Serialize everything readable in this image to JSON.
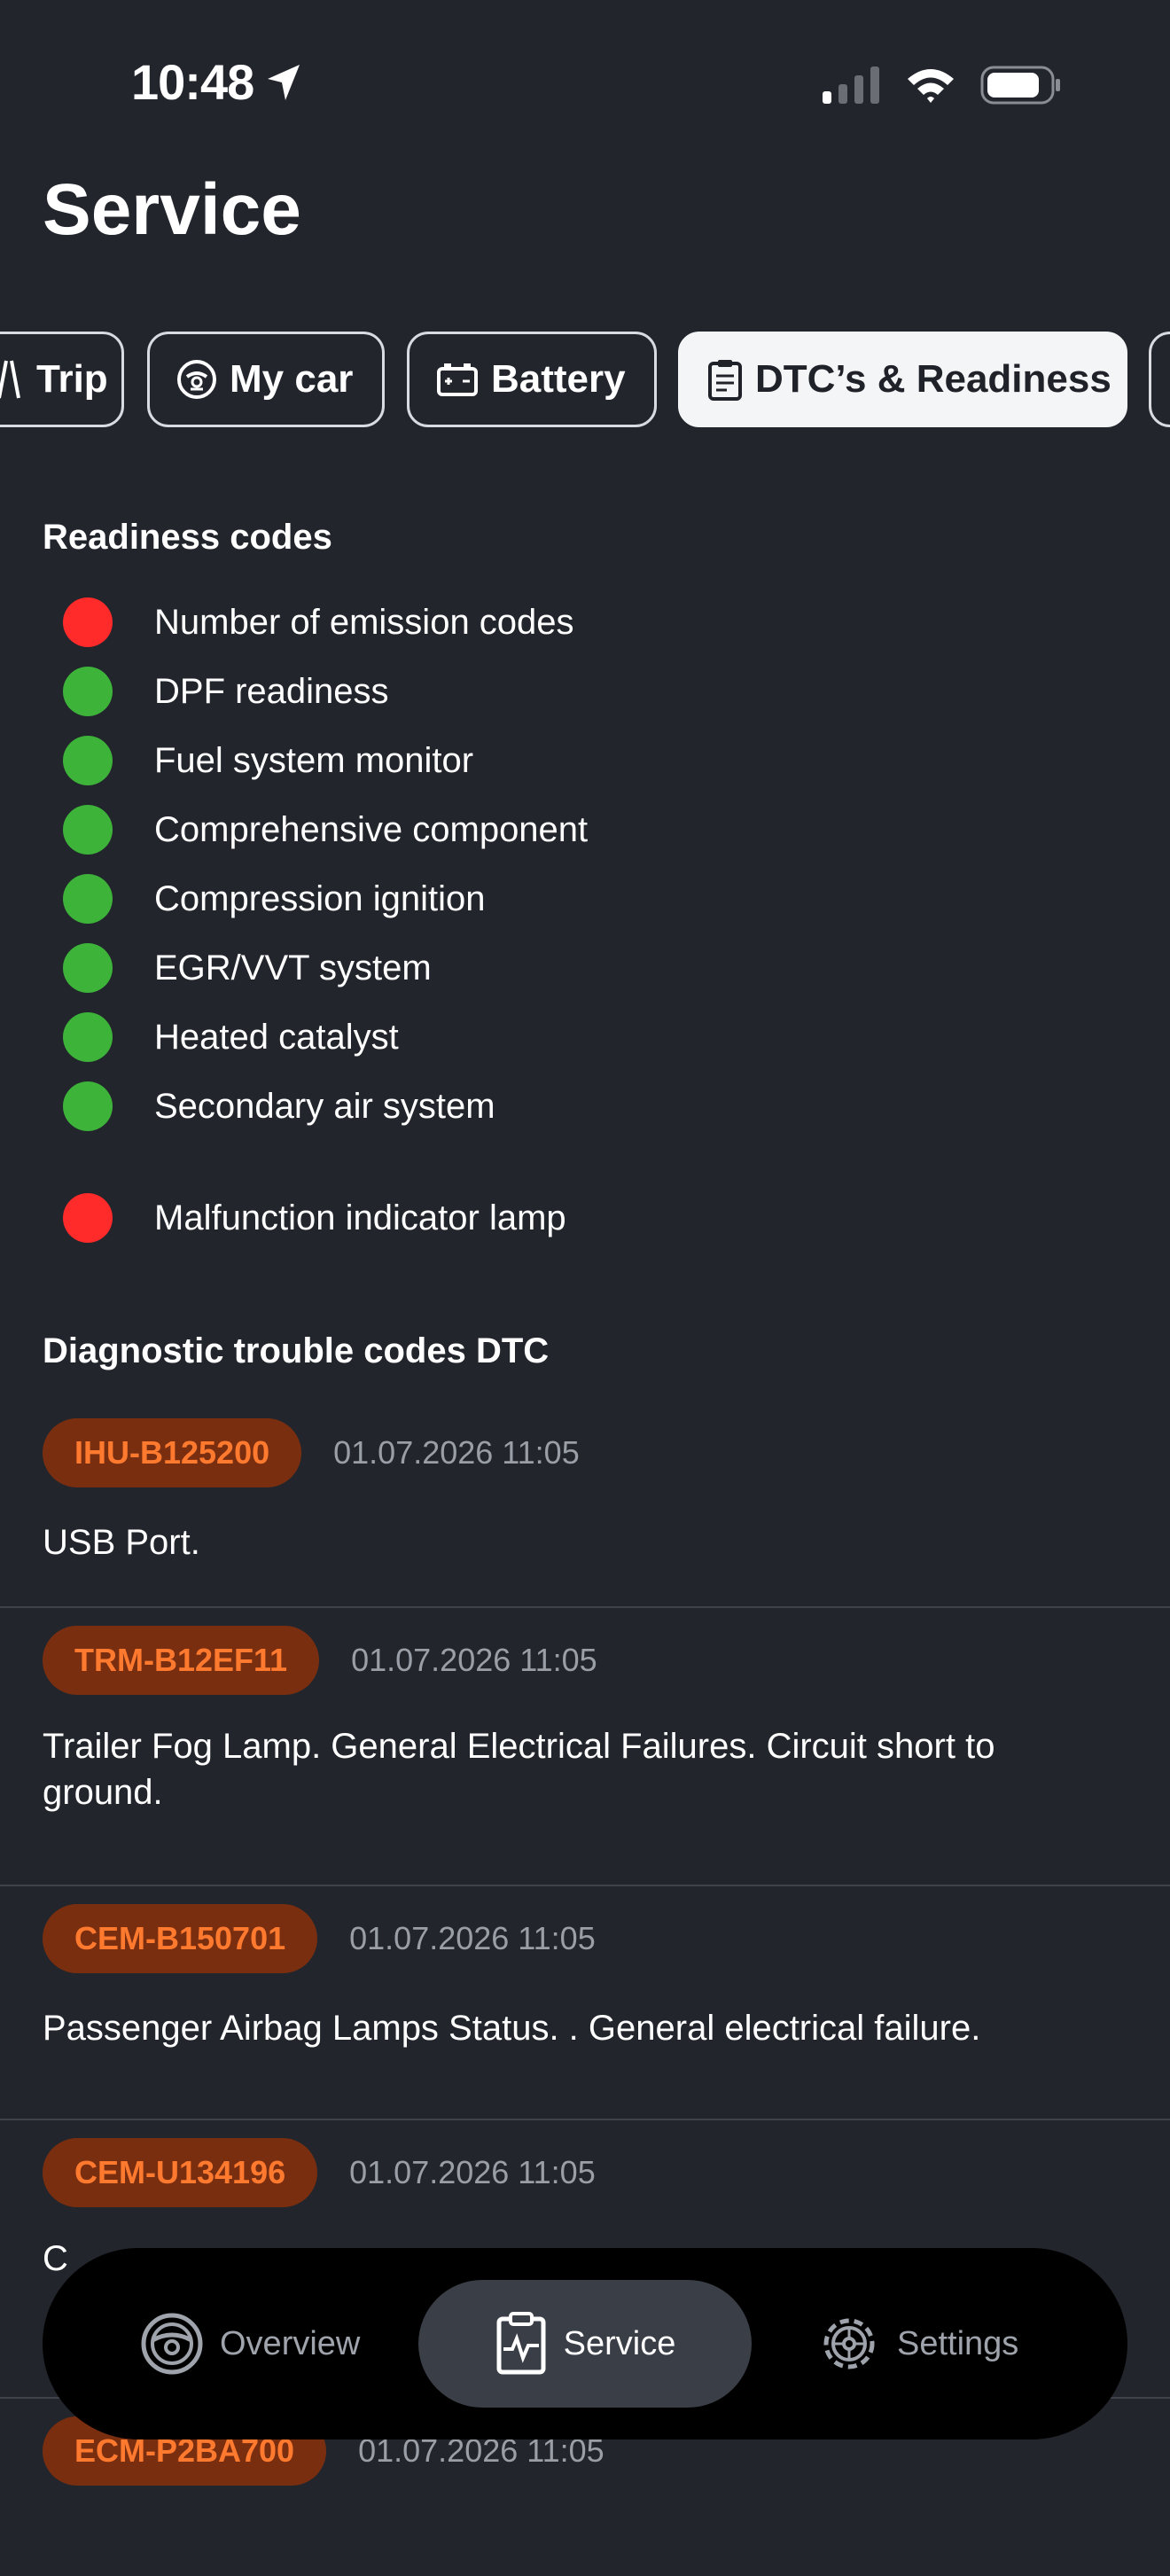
{
  "status_bar": {
    "time": "10:48"
  },
  "page": {
    "title": "Service"
  },
  "tabs": [
    {
      "label": "Trip",
      "icon": "trip-icon",
      "active": false
    },
    {
      "label": "My car",
      "icon": "car-dashboard-icon",
      "active": false
    },
    {
      "label": "Battery",
      "icon": "battery-icon",
      "active": false
    },
    {
      "label": "DTC’s & Readiness",
      "icon": "clipboard-icon",
      "active": true
    }
  ],
  "readiness": {
    "title": "Readiness codes",
    "items": [
      {
        "label": "Number of emission codes",
        "status": "fail",
        "color": "#ff2a2a"
      },
      {
        "label": "DPF readiness",
        "status": "ok",
        "color": "#3db33a"
      },
      {
        "label": "Fuel system monitor",
        "status": "ok",
        "color": "#3db33a"
      },
      {
        "label": "Comprehensive component",
        "status": "ok",
        "color": "#3db33a"
      },
      {
        "label": "Compression ignition",
        "status": "ok",
        "color": "#3db33a"
      },
      {
        "label": "EGR/VVT system",
        "status": "ok",
        "color": "#3db33a"
      },
      {
        "label": "Heated catalyst",
        "status": "ok",
        "color": "#3db33a"
      },
      {
        "label": "Secondary air system",
        "status": "ok",
        "color": "#3db33a"
      },
      {
        "label": "Malfunction indicator lamp",
        "status": "fail",
        "color": "#ff2a2a"
      }
    ]
  },
  "dtc": {
    "title": "Diagnostic trouble codes DTC",
    "items": [
      {
        "code": "IHU-B125200",
        "time": "01.07.2026 11:05",
        "description": "USB Port."
      },
      {
        "code": "TRM-B12EF11",
        "time": "01.07.2026 11:05",
        "description": "Trailer Fog Lamp. General Electrical Failures. Circuit short to ground."
      },
      {
        "code": "CEM-B150701",
        "time": "01.07.2026 11:05",
        "description": "Passenger Airbag Lamps Status. . General electrical failure."
      },
      {
        "code": "CEM-U134196",
        "time": "01.07.2026 11:05",
        "description": "C"
      },
      {
        "code": "ECM-P2BA700",
        "time": "01.07.2026 11:05",
        "description": ""
      }
    ]
  },
  "tab_bar": {
    "items": [
      {
        "label": "Overview",
        "icon": "steering-wheel-icon",
        "active": false
      },
      {
        "label": "Service",
        "icon": "service-clipboard-icon",
        "active": true
      },
      {
        "label": "Settings",
        "icon": "gear-icon",
        "active": false
      }
    ]
  }
}
